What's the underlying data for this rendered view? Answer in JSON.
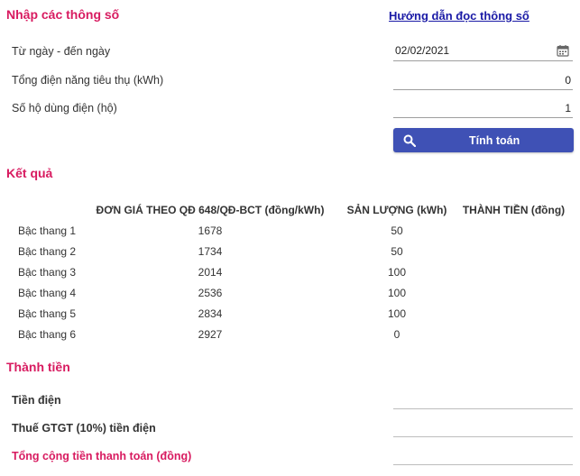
{
  "input_section": {
    "title": "Nhập các thông số",
    "help_link": "Hướng dẫn đọc thông số",
    "date_range": {
      "label": "Từ ngày - đến ngày",
      "value": "02/02/2021"
    },
    "consumption": {
      "label": "Tổng điện năng tiêu thụ (kWh)",
      "value": "0"
    },
    "households": {
      "label": "Số hộ dùng điện (hộ)",
      "value": "1"
    },
    "calc_button": "Tính toán"
  },
  "result_section": {
    "title": "Kết quả",
    "columns": [
      "ĐƠN GIÁ THEO QĐ 648/QĐ-BCT (đồng/kWh)",
      "SẢN LƯỢNG (kWh)",
      "THÀNH TIỀN (đồng)"
    ],
    "rows": [
      {
        "tier": "Bậc thang 1",
        "price": "1678",
        "quantity": "50",
        "amount": ""
      },
      {
        "tier": "Bậc thang 2",
        "price": "1734",
        "quantity": "50",
        "amount": ""
      },
      {
        "tier": "Bậc thang 3",
        "price": "2014",
        "quantity": "100",
        "amount": ""
      },
      {
        "tier": "Bậc thang 4",
        "price": "2536",
        "quantity": "100",
        "amount": ""
      },
      {
        "tier": "Bậc thang 5",
        "price": "2834",
        "quantity": "100",
        "amount": ""
      },
      {
        "tier": "Bậc thang 6",
        "price": "2927",
        "quantity": "0",
        "amount": ""
      }
    ]
  },
  "total_section": {
    "title": "Thành tiền",
    "electricity_cost": {
      "label": "Tiền điện",
      "value": ""
    },
    "vat": {
      "label": "Thuế GTGT (10%) tiền điện",
      "value": ""
    },
    "grand_total": {
      "label": "Tổng cộng tiền thanh toán (đồng)",
      "value": ""
    }
  },
  "colors": {
    "accent": "#d81b60",
    "button": "#3f51b5",
    "link": "#1a1aa6"
  },
  "icons": {
    "calendar": "calendar-icon",
    "search": "search-icon"
  }
}
